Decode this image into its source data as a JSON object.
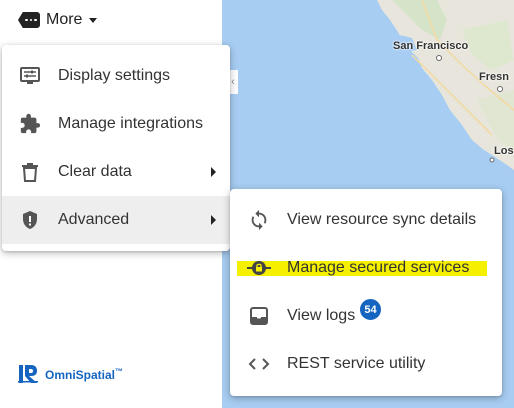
{
  "toolbar": {
    "more_label": "More"
  },
  "menu": {
    "items": [
      {
        "label": "Display settings",
        "icon": "display-settings-icon"
      },
      {
        "label": "Manage integrations",
        "icon": "puzzle-icon"
      },
      {
        "label": "Clear data",
        "icon": "trash-icon",
        "has_submenu": true
      },
      {
        "label": "Advanced",
        "icon": "shield-icon",
        "has_submenu": true,
        "active": true
      }
    ]
  },
  "submenu": {
    "items": [
      {
        "label": "View resource sync details",
        "icon": "sync-icon"
      },
      {
        "label": "Manage secured services",
        "icon": "lock-circle-icon",
        "highlighted": true
      },
      {
        "label": "View logs",
        "icon": "inbox-icon",
        "badge": "54"
      },
      {
        "label": "REST service utility",
        "icon": "code-icon"
      }
    ]
  },
  "map": {
    "labels": [
      "San Francisco",
      "Fresn",
      "Los"
    ]
  },
  "brand": {
    "name": "OmniSpatial",
    "tm": "™"
  },
  "colors": {
    "accent": "#1565c0",
    "highlight": "#f6f20e",
    "map_water": "#a7cdf2",
    "map_land": "#e8e4d8"
  }
}
